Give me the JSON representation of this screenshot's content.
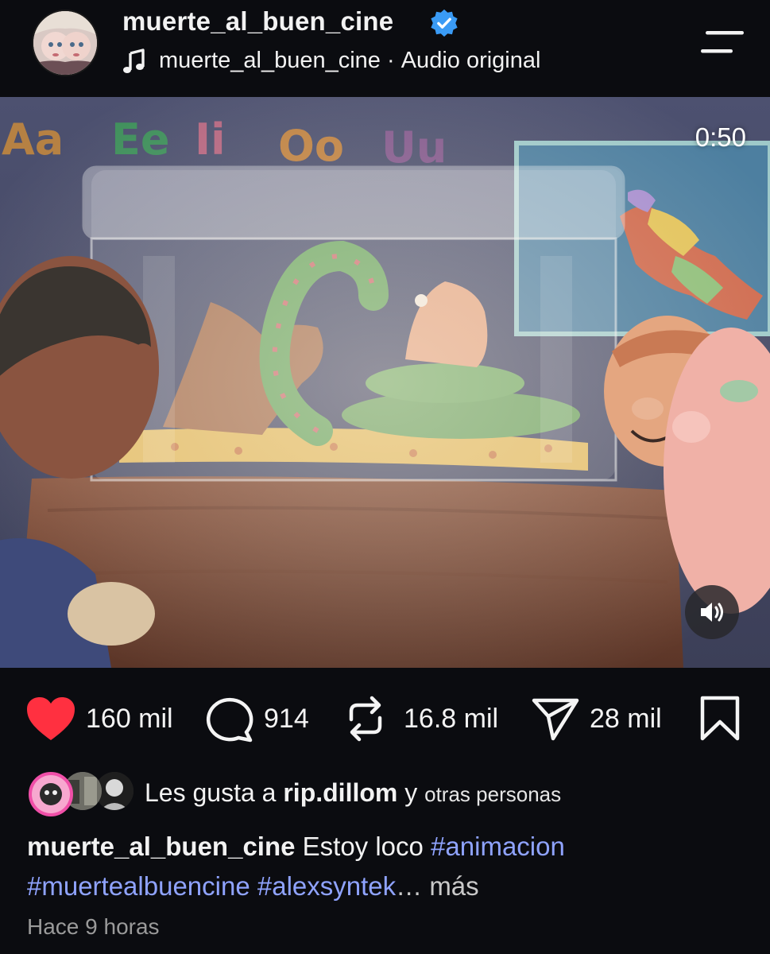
{
  "header": {
    "username": "muerte_al_buen_cine",
    "audio_user": "muerte_al_buen_cine",
    "audio_separator": " · ",
    "audio_label": "Audio original"
  },
  "video": {
    "duration": "0:50",
    "wall_letters": "Aa Ee Ii Oo Uu"
  },
  "actions": {
    "likes": "160 mil",
    "comments": "914",
    "reposts": "16.8 mil",
    "shares": "28 mil"
  },
  "likes_line": {
    "prefix": "Les gusta a ",
    "user": "rip.dillom",
    "joiner": " y ",
    "suffix": "otras personas"
  },
  "caption": {
    "user": "muerte_al_buen_cine",
    "text": " Estoy loco ",
    "tag1": "#animacion",
    "tag2": "#muertealbuencine",
    "tag3": "#alexsyntek",
    "ellipsis": "… ",
    "more": "más"
  },
  "timestamp": "Hace 9 horas",
  "colors": {
    "background": "#0b0c10",
    "heart": "#ff3040",
    "hashtag": "#8fa3ff",
    "verified": "#3a9bf5"
  },
  "icons": [
    "verified-badge-icon",
    "music-note-icon",
    "menu-icon",
    "volume-icon",
    "heart-icon",
    "comment-icon",
    "repost-icon",
    "share-icon",
    "bookmark-icon"
  ]
}
